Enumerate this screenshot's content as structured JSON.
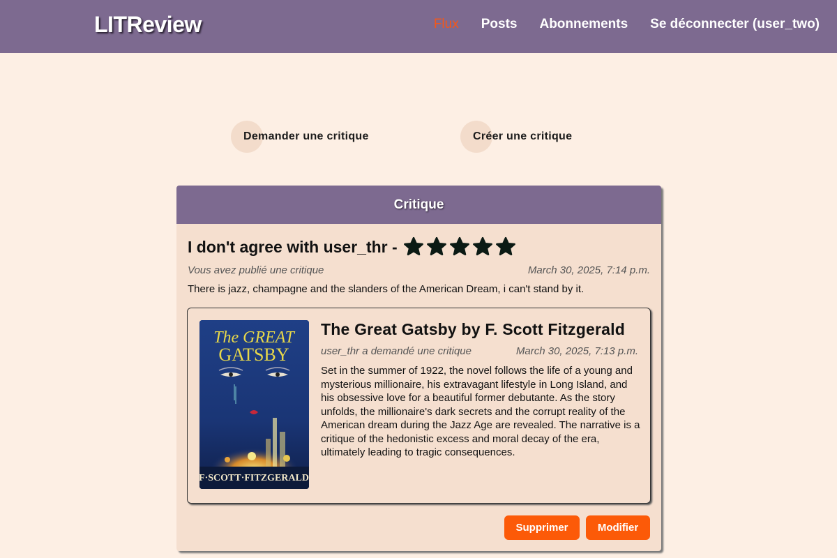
{
  "header": {
    "brand": "LITReview",
    "nav": [
      {
        "label": "Flux",
        "active": true
      },
      {
        "label": "Posts",
        "active": false
      },
      {
        "label": "Abonnements",
        "active": false
      },
      {
        "label": "Se déconnecter (user_two)",
        "active": false
      }
    ],
    "background_color": "#7d6a90",
    "active_color": "#f2571b"
  },
  "actions": {
    "ask_review": "Demander une critique",
    "create_review": "Créer une critique"
  },
  "review_card": {
    "header": "Critique",
    "title": "I don't agree with user_thr -",
    "rating": 5,
    "rating_max": 5,
    "star_icon": "star-icon",
    "author_text": "Vous avez publié une critique",
    "timestamp": "March 30, 2025, 7:14 p.m.",
    "body": "There is jazz, champagne and the slanders of the American Dream, i can't stand by it.",
    "ticket": {
      "title": "The Great Gatsby by F. Scott Fitzgerald",
      "author_text": "user_thr a demandé une critique",
      "timestamp": "March 30, 2025, 7:13 p.m.",
      "description": "Set in the summer of 1922, the novel follows the life of a young and mysterious millionaire, his extravagant lifestyle in Long Island, and his obsessive love for a beautiful former debutante. As the story unfolds, the millionaire's dark secrets and the corrupt reality of the American dream during the Jazz Age are revealed. The narrative is a critique of the hedonistic excess and moral decay of the era, ultimately leading to tragic consequences.",
      "cover": {
        "title_line1": "The GREAT",
        "title_line2": "GATSBY",
        "author": "F·SCOTT·FITZGERALD"
      }
    },
    "delete_label": "Supprimer",
    "edit_label": "Modifier",
    "button_color": "#fc5a08"
  }
}
